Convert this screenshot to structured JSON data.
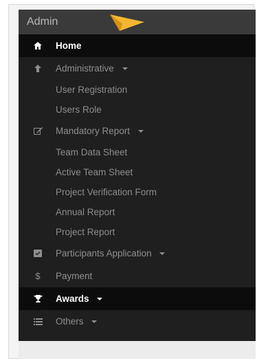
{
  "sidebar": {
    "title": "Admin",
    "items": [
      {
        "label": "Home",
        "icon": "home-icon",
        "active": true
      },
      {
        "label": "Administrative",
        "icon": "upload-arrow-icon",
        "dropdown": true
      },
      {
        "label": "User Registration",
        "sub": true
      },
      {
        "label": "Users Role",
        "sub": true
      },
      {
        "label": "Mandatory Report",
        "icon": "edit-icon",
        "dropdown": true
      },
      {
        "label": "Team Data Sheet",
        "sub": true
      },
      {
        "label": "Active Team Sheet",
        "sub": true
      },
      {
        "label": "Project Verification Form",
        "sub": true
      },
      {
        "label": "Annual Report",
        "sub": true
      },
      {
        "label": "Project Report",
        "sub": true
      },
      {
        "label": "Participants Application",
        "icon": "check-square-icon",
        "dropdown": true
      },
      {
        "label": "Payment",
        "icon": "dollar-icon"
      },
      {
        "label": "Awards",
        "icon": "trophy-icon",
        "dropdown": true,
        "active": true
      },
      {
        "label": "Others",
        "icon": "list-icon",
        "dropdown": true
      }
    ]
  },
  "colors": {
    "panel": "#1f1f1f",
    "header": "#3a3a3a",
    "active": "#0c0c0c",
    "cursor": "#f5b731"
  }
}
